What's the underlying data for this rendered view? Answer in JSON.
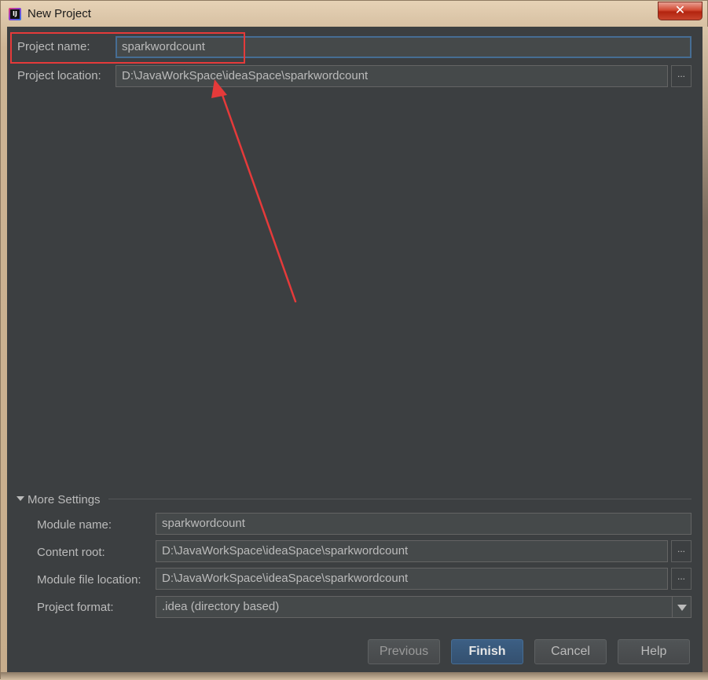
{
  "window": {
    "title": "New Project",
    "close_glyph": "✕"
  },
  "project": {
    "name_label": "Project name:",
    "name_value": "sparkwordcount",
    "location_label": "Project location:",
    "location_value": "D:\\JavaWorkSpace\\ideaSpace\\sparkwordcount"
  },
  "more_settings": {
    "header": "More Settings",
    "module_name_label": "Module name:",
    "module_name_value": "sparkwordcount",
    "content_root_label": "Content root:",
    "content_root_value": "D:\\JavaWorkSpace\\ideaSpace\\sparkwordcount",
    "module_file_label": "Module file location:",
    "module_file_value": "D:\\JavaWorkSpace\\ideaSpace\\sparkwordcount",
    "format_label": "Project format:",
    "format_value": ".idea (directory based)"
  },
  "browse_glyph": "...",
  "buttons": {
    "previous": "Previous",
    "finish": "Finish",
    "cancel": "Cancel",
    "help": "Help"
  },
  "annotation": {
    "color": "#e53a3a"
  }
}
